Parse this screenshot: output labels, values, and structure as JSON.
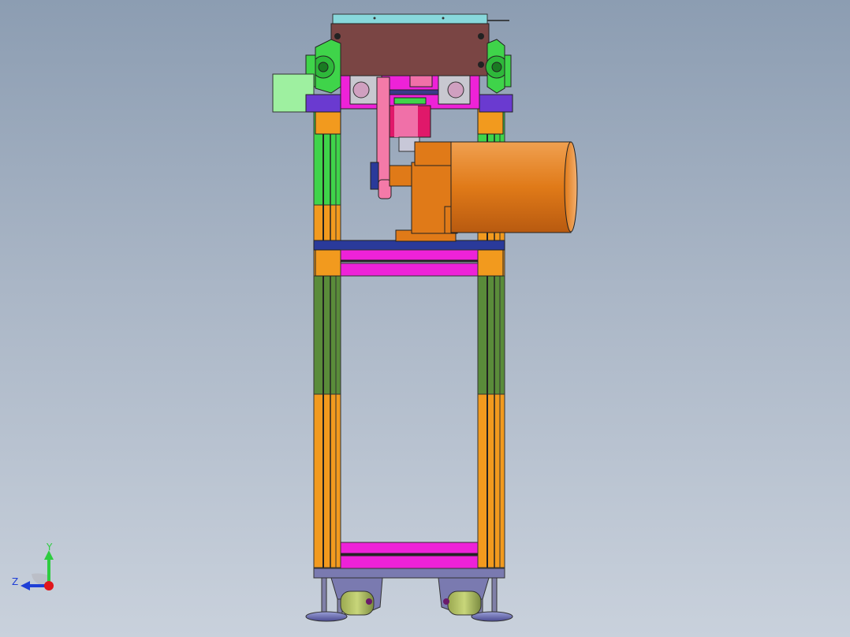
{
  "viewport": {
    "background_top": "#8c9db2",
    "background_bottom": "#c9d1dc"
  },
  "triad": {
    "y_label": "Y",
    "z_label": "Z",
    "y_color": "#2ecc40",
    "z_color": "#1f3fd6",
    "x_color": "#e0151b"
  },
  "model": {
    "name_icon": "cad-assembly-front-view",
    "colors": {
      "frame_orange": "#f29a1e",
      "frame_green": "#5a8c3a",
      "bright_green": "#3fd44a",
      "magenta": "#ee22d8",
      "brown_box": "#7a4544",
      "cyan_top": "#88d8dc",
      "motor_orange": "#e07a18",
      "blue_plate": "#2a3a9a",
      "purple": "#6a3ad0",
      "pink": "#f47aa8",
      "light_green_block": "#9ef0a0",
      "grey_blue_base": "#7a7ab0"
    }
  }
}
